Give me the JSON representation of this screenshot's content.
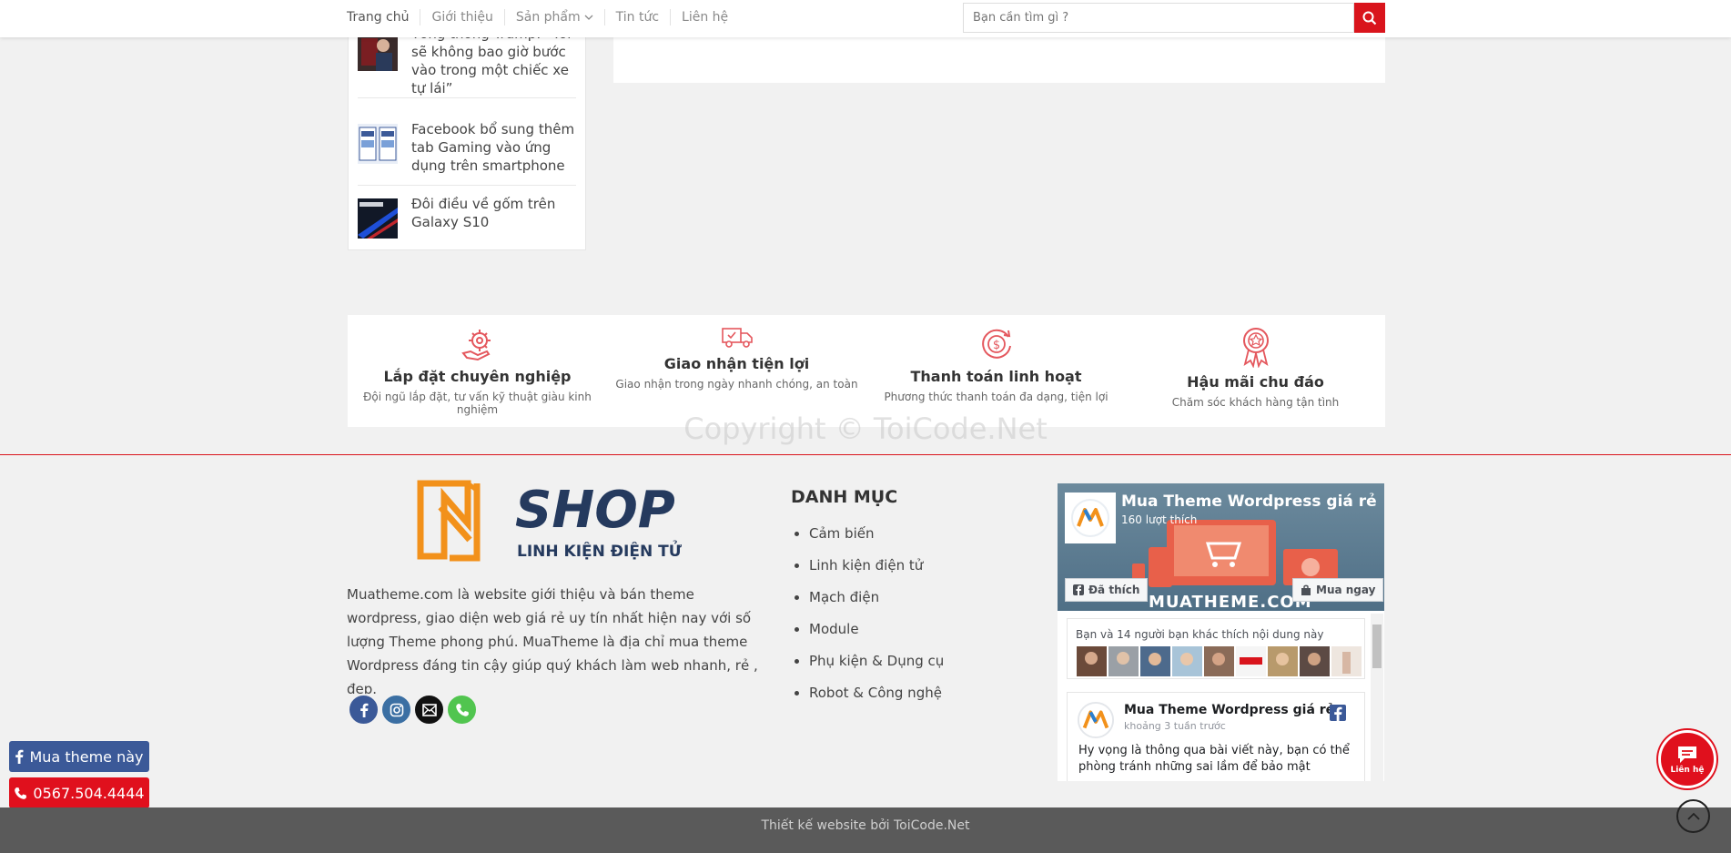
{
  "header": {
    "nav": [
      {
        "label": "Trang chủ"
      },
      {
        "label": "Giới thiệu"
      },
      {
        "label": "Sản phẩm"
      },
      {
        "label": "Tin tức"
      },
      {
        "label": "Liên hệ"
      }
    ],
    "search_placeholder": "Bạn cần tìm gì ?",
    "accent": "#d9141c"
  },
  "recent_posts": [
    {
      "title": "Tổng thống Trump: “Tôi sẽ không bao giờ bước vào trong một chiếc xe tự lái”"
    },
    {
      "title": "Facebook bổ sung thêm tab Gaming vào ứng dụng trên smartphone"
    },
    {
      "title": "Đôi điều về gốm trên Galaxy S10"
    }
  ],
  "features": [
    {
      "title": "Lắp đặt chuyên nghiệp",
      "desc": "Đội ngũ lắp đặt, tư vấn kỹ thuật giàu kinh nghiệm",
      "icon": "gear-hand-icon"
    },
    {
      "title": "Giao nhận tiện lợi",
      "desc": "Giao nhận trong ngày nhanh chóng, an toàn",
      "icon": "truck-icon"
    },
    {
      "title": "Thanh toán linh hoạt",
      "desc": "Phương thức thanh toán đa dạng, tiện lợi",
      "icon": "dollar-cycle-icon"
    },
    {
      "title": "Hậu mãi chu đáo",
      "desc": "Chăm sóc khách hàng tận tình",
      "icon": "award-ribbon-icon"
    }
  ],
  "watermark": "Copyright © ToiCode.Net",
  "footer": {
    "logo_word": "SHOP",
    "logo_sub": "LINH KIỆN ĐIỆN TỬ",
    "about": "Muatheme.com là website giới thiệu và bán theme wordpress, giao diện web giá rẻ uy tín nhất hiện nay với số lượng Theme phong phú. MuaTheme là địa chỉ mua theme Wordpress đáng tin cậy giúp quý khách làm web nhanh, rẻ , đẹp.",
    "socials": [
      {
        "icon": "facebook-icon",
        "color": "#3b5998"
      },
      {
        "icon": "instagram-icon",
        "color": "#3b6fa3"
      },
      {
        "icon": "email-icon",
        "color": "#111111"
      },
      {
        "icon": "phone-icon",
        "color": "#51c54f"
      }
    ],
    "category_title": "DANH MỤC",
    "categories": [
      {
        "label": "Cảm biến"
      },
      {
        "label": "Linh kiện điện tử"
      },
      {
        "label": "Mạch điện"
      },
      {
        "label": "Module"
      },
      {
        "label": "Phụ kiện & Dụng cụ"
      },
      {
        "label": "Robot & Công nghệ"
      }
    ],
    "fb": {
      "page_name": "Mua Theme Wordpress giá rẻ",
      "likes": "160 lượt thích",
      "like_btn": "Đã thích",
      "shop_btn": "Mua ngay",
      "cover_brand": "MUATHEME.COM",
      "friends_text": "Bạn và 14 người bạn khác thích nội dung này",
      "post_name": "Mua Theme Wordpress giá rẻ",
      "post_time": "khoảng 3 tuần trước",
      "post_body": "Hy vọng là thông qua bài viết này, bạn có thể phòng tránh những sai lầm để bảo mật"
    }
  },
  "floating": {
    "fb_label": "Mua theme này",
    "phone_label": "0567.504.4444",
    "chat_label": "Liên hệ"
  },
  "bottom": {
    "credit": "Thiết kế website bởi ToiCode.Net"
  }
}
